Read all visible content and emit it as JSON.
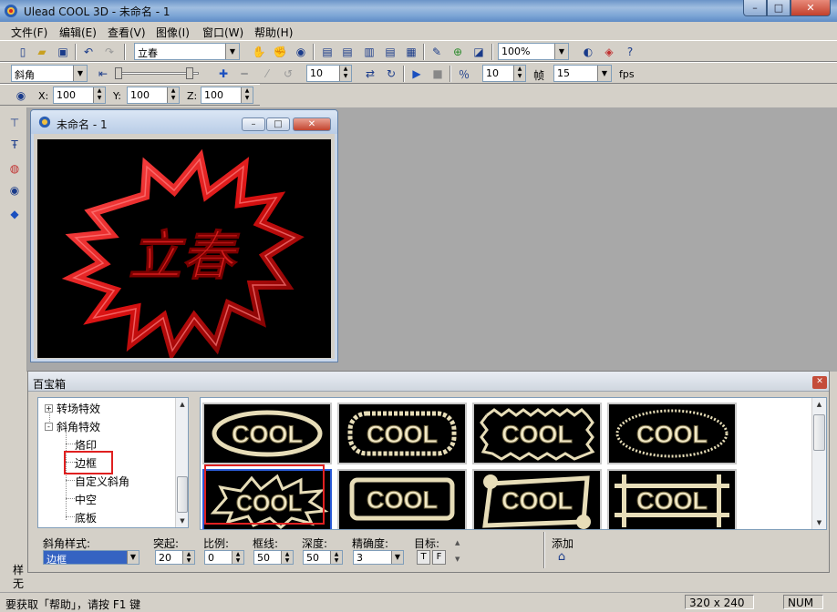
{
  "app": {
    "title": "Ulead COOL 3D - 未命名 - 1",
    "window_buttons": {
      "minimize": "–",
      "maximize": "□",
      "close": "✕"
    }
  },
  "menu": {
    "items": [
      "文件(F)",
      "编辑(E)",
      "查看(V)",
      "图像(I)",
      "窗口(W)",
      "帮助(H)"
    ]
  },
  "toolbar1": {
    "object_combo": "立春",
    "zoom_combo": "100%"
  },
  "toolbar2": {
    "effect_combo": "斜角",
    "frame_value_1": "10",
    "frame_value_2": "10",
    "frame_label": "帧",
    "fps_value": "15",
    "fps_label": "fps"
  },
  "toolbar3": {
    "x_label": "X:",
    "x_value": "100",
    "y_label": "Y:",
    "y_value": "100",
    "z_label": "Z:",
    "z_value": "100"
  },
  "child_window": {
    "title": "未命名 - 1",
    "canvas_text": "立春"
  },
  "panel": {
    "title": "百宝箱",
    "tree": {
      "items": [
        {
          "label": "转场特效",
          "expander": "+"
        },
        {
          "label": "斜角特效",
          "expander": "-"
        },
        {
          "label": "烙印"
        },
        {
          "label": "边框"
        },
        {
          "label": "自定义斜角"
        },
        {
          "label": "中空"
        },
        {
          "label": "底板"
        }
      ]
    },
    "thumbnails": [
      "COOL",
      "COOL",
      "COOL",
      "COOL",
      "COOL",
      "COOL",
      "COOL",
      "COOL"
    ],
    "params": {
      "style_label": "斜角样式:",
      "style_value": "边框",
      "protrude_label": "突起:",
      "protrude_value": "20",
      "ratio_label": "比例:",
      "ratio_value": "0",
      "border_label": "框线:",
      "border_value": "50",
      "depth_label": "深度:",
      "depth_value": "50",
      "precision_label": "精确度:",
      "precision_value": "3",
      "target_label": "目标:",
      "target_t": "T",
      "target_f": "F",
      "add_label": "添加"
    }
  },
  "side_stub": {
    "line1": "样",
    "line2": "无"
  },
  "statusbar": {
    "help_text": "要获取「帮助」，请按 F1 键",
    "size": "320 x 240",
    "num": "NUM"
  },
  "colors": {
    "accent_red": "#e02020",
    "canvas_bg": "#000000",
    "mdi_bg": "#a8a8a8",
    "thumbnail_metal": "#e7ddb8"
  }
}
